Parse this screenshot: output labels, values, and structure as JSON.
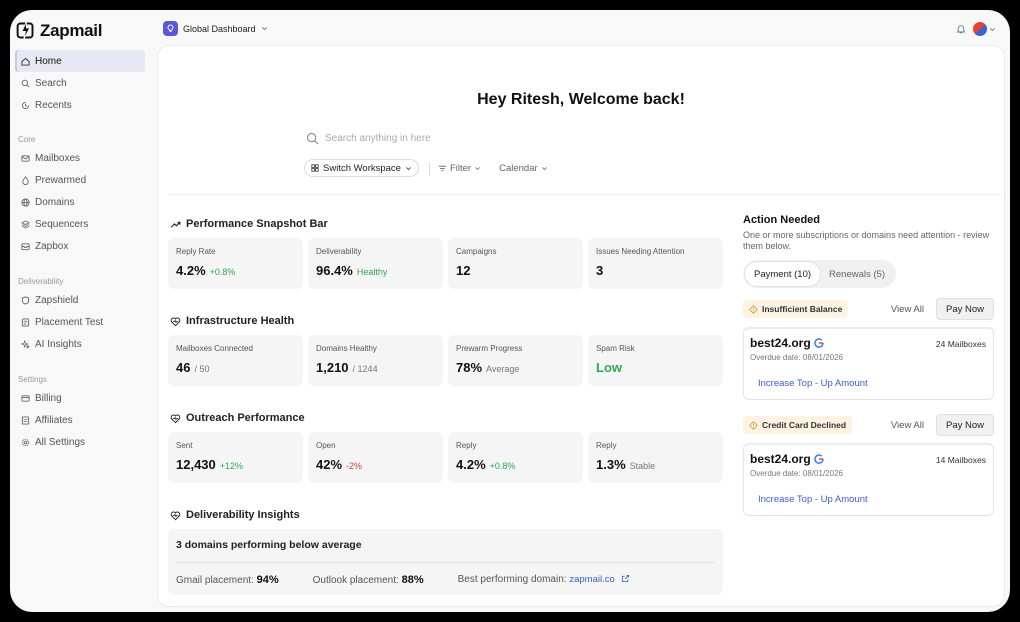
{
  "app": {
    "name": "Zapmail"
  },
  "workspace": {
    "label": "Global Dashboard"
  },
  "sidebar": {
    "top_items": [
      {
        "label": "Home",
        "icon": "home-icon",
        "active": true
      },
      {
        "label": "Search",
        "icon": "search-icon"
      },
      {
        "label": "Recents",
        "icon": "recents-icon"
      }
    ],
    "sections": [
      {
        "title": "Core",
        "items": [
          {
            "label": "Mailboxes",
            "icon": "mailbox-icon"
          },
          {
            "label": "Prewarmed",
            "icon": "prewarmed-icon"
          },
          {
            "label": "Domains",
            "icon": "globe-icon"
          },
          {
            "label": "Sequencers",
            "icon": "sequencer-icon"
          },
          {
            "label": "Zapbox",
            "icon": "zapbox-icon"
          }
        ]
      },
      {
        "title": "Deliverability",
        "items": [
          {
            "label": "Zapshield",
            "icon": "shield-icon"
          },
          {
            "label": "Placement Test",
            "icon": "placement-icon"
          },
          {
            "label": "AI Insights",
            "icon": "sparkle-icon"
          }
        ]
      },
      {
        "title": "Settings",
        "items": [
          {
            "label": "Billing",
            "icon": "billing-icon"
          },
          {
            "label": "Affiliates",
            "icon": "affiliates-icon"
          },
          {
            "label": "All Settings",
            "icon": "gear-icon"
          }
        ]
      }
    ]
  },
  "main": {
    "greeting": "Hey Ritesh, Welcome back!",
    "search_placeholder": "Search anything in here",
    "switch_workspace": "Switch Workspace",
    "filter": "Filter",
    "calendar": "Calendar"
  },
  "performance": {
    "title": "Performance Snapshot Bar",
    "cards": [
      {
        "label": "Reply Rate",
        "value": "4.2%",
        "note": "+0.8%",
        "tone": "g"
      },
      {
        "label": "Deliverability",
        "value": "96.4%",
        "note": "Healthy",
        "tone": "g"
      },
      {
        "label": "Campaigns",
        "value": "12",
        "note": "",
        "tone": "m"
      },
      {
        "label": "Issues Needing Attention",
        "value": "3",
        "note": "",
        "tone": "m"
      }
    ]
  },
  "infrastructure": {
    "title": "Infrastructure Health",
    "cards": [
      {
        "label": "Mailboxes Connected",
        "value": "46",
        "note": "/ 50",
        "tone": "m"
      },
      {
        "label": "Domains Healthy",
        "value": "1,210",
        "note": "/ 1244",
        "tone": "m"
      },
      {
        "label": "Prewarm Progress",
        "value": "78%",
        "note": "Average",
        "tone": "m"
      },
      {
        "label": "Spam Risk",
        "value": "Low",
        "note": "",
        "tone": "g"
      }
    ]
  },
  "outreach": {
    "title": "Outreach Performance",
    "cards": [
      {
        "label": "Sent",
        "value": "12,430",
        "note": "+12%",
        "tone": "g"
      },
      {
        "label": "Open",
        "value": "42%",
        "note": "-2%",
        "tone": "r"
      },
      {
        "label": "Reply",
        "value": "4.2%",
        "note": "+0.8%",
        "tone": "g"
      },
      {
        "label": "Reply",
        "value": "1.3%",
        "note": "Stable",
        "tone": "m"
      }
    ]
  },
  "insights": {
    "title": "Deliverability Insights",
    "headline": "3 domains performing below average",
    "gmail_label": "Gmail placement:",
    "gmail_value": "94%",
    "outlook_label": "Outlook placement:",
    "outlook_value": "88%",
    "best_label": "Best performing domain:",
    "best_value": "zapmail.co"
  },
  "action_needed": {
    "title": "Action Needed",
    "subtitle": "One or more subscriptions or domains need attention - review them below.",
    "tabs": [
      "Payment (10)",
      "Renewals (5)"
    ],
    "view_all": "View All",
    "pay_now": "Pay Now",
    "alerts": [
      {
        "badge": "Insufficient Balance",
        "domain": "best24.org",
        "mailboxes": "24 Mailboxes",
        "due": "Overdue date: 08/01/2026",
        "action": "Increase Top - Up Amount"
      },
      {
        "badge": "Credit Card Declined",
        "domain": "best24.org",
        "mailboxes": "14 Mailboxes",
        "due": "Overdue date: 08/01/2026",
        "action": "Increase Top - Up Amount"
      }
    ]
  },
  "colors": {
    "accent": "#5b57d9",
    "link": "#3b5bdb",
    "positive": "#2fa84f",
    "negative": "#d64242",
    "warning_bg": "#fdf3e3"
  }
}
